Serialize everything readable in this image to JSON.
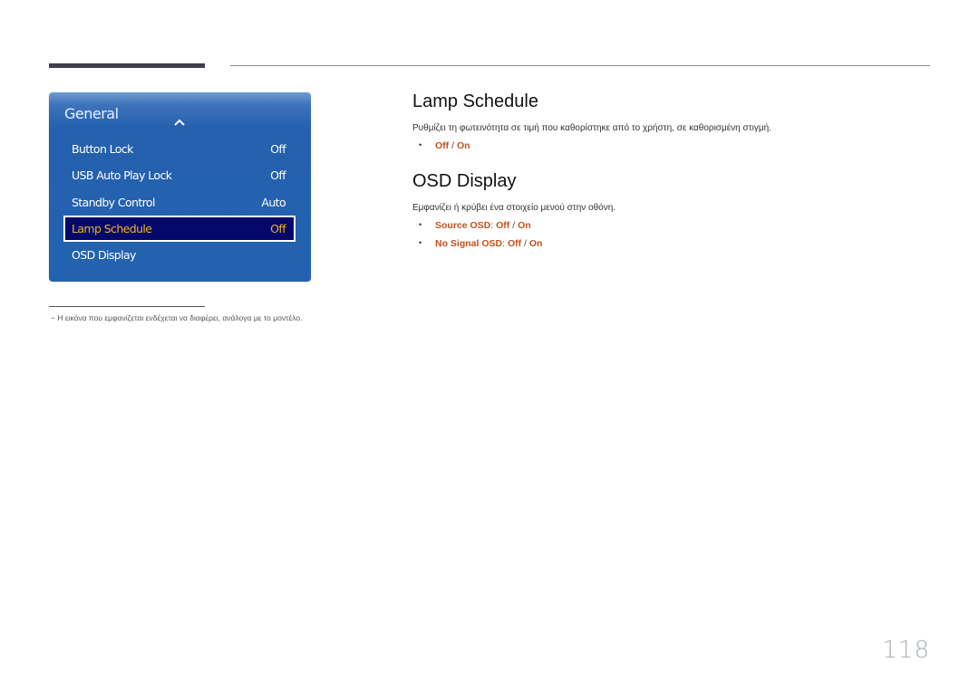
{
  "menu": {
    "title": "General",
    "items": [
      {
        "label": "Button Lock",
        "value": "Off"
      },
      {
        "label": "USB Auto Play Lock",
        "value": "Off"
      },
      {
        "label": "Standby Control",
        "value": "Auto"
      },
      {
        "label": "Lamp Schedule",
        "value": "Off",
        "selected": true
      },
      {
        "label": "OSD Display",
        "value": ""
      }
    ],
    "colors": {
      "panel": "#2262ae",
      "selected_bg": "#05086a",
      "selected_text": "#f0b024"
    }
  },
  "sections": [
    {
      "title": "Lamp Schedule",
      "description": "Ρυθμίζει τη φωτεινότητα σε τιμή που καθορίστηκε από το χρήστη, σε καθορισμένη στιγμή.",
      "bullets": [
        {
          "prefix": "",
          "opt1": "Off",
          "sep": " / ",
          "opt2": "On"
        }
      ]
    },
    {
      "title": "OSD Display",
      "description": "Εμφανίζει ή κρύβει ένα στοιχείο μενού στην οθόνη.",
      "bullets": [
        {
          "prefix": "Source OSD",
          "colon": ": ",
          "opt1": "Off",
          "sep": " / ",
          "opt2": "On"
        },
        {
          "prefix": "No Signal OSD",
          "colon": ": ",
          "opt1": "Off",
          "sep": " / ",
          "opt2": "On"
        }
      ]
    }
  ],
  "bullet_glyph": "•",
  "footnote": "−  Η εικόνα που εμφανίζεται ενδέχεται να διαφέρει, ανάλογα με το μοντέλο.",
  "page_number": "118",
  "accent_color": "#c4511c"
}
